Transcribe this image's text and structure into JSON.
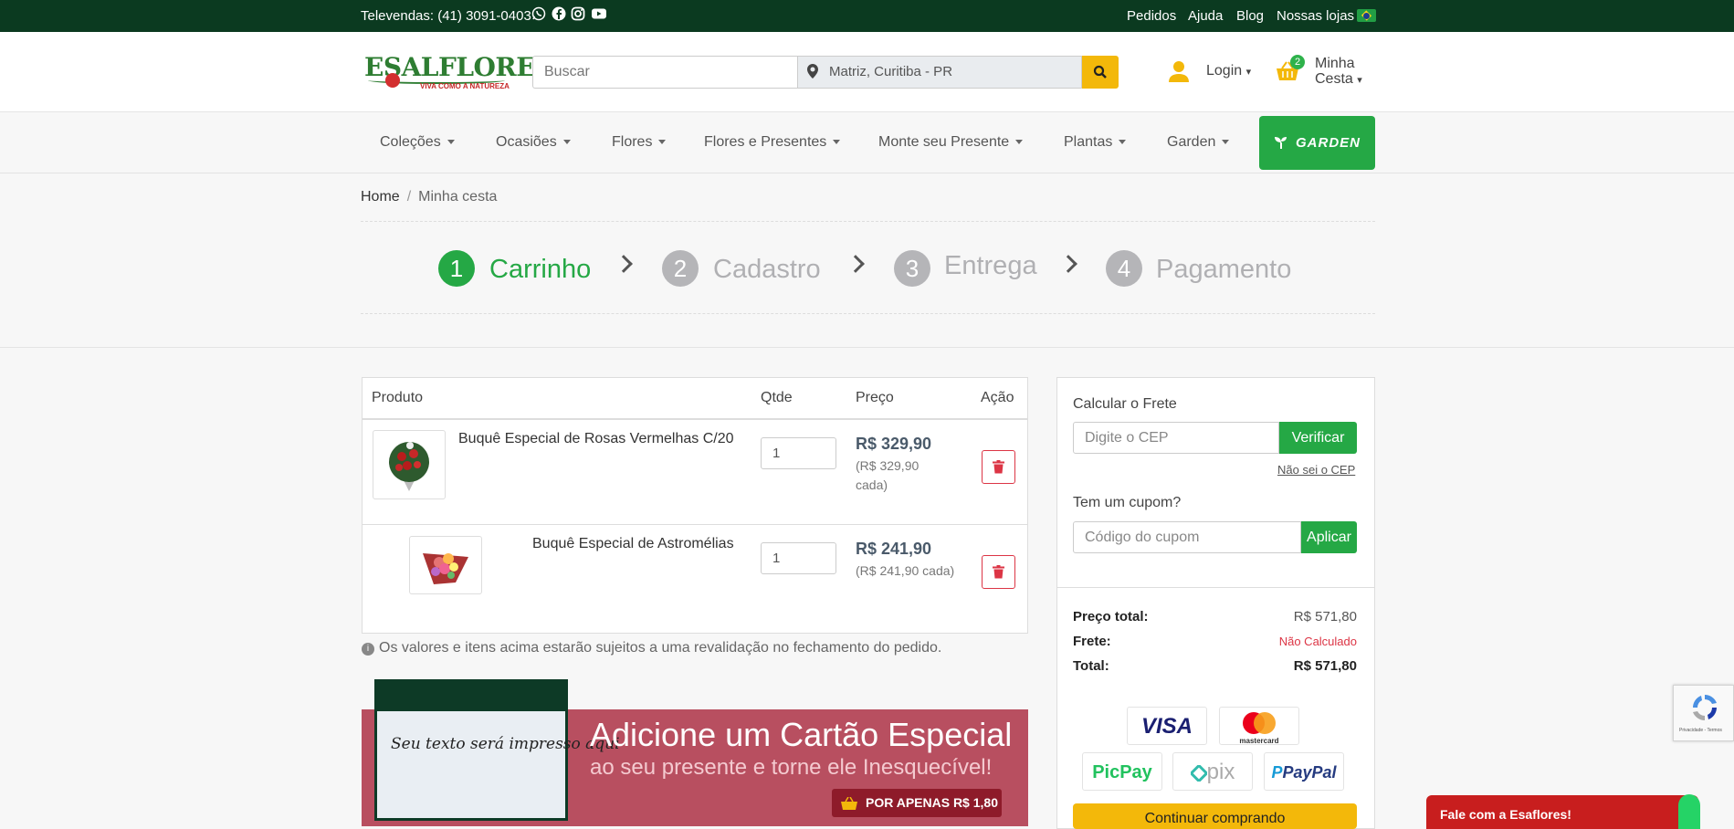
{
  "topbar": {
    "phone": "Televendas: (41) 3091-0403",
    "links": [
      "Pedidos",
      "Ajuda",
      "Blog",
      "Nossas lojas"
    ],
    "social_icons": [
      "whatsapp-icon",
      "facebook-icon",
      "instagram-icon",
      "youtube-icon"
    ]
  },
  "header": {
    "logo": "ESALFLORES",
    "logo_tagline": "VIVA COMO A NATUREZA",
    "search_placeholder": "Buscar",
    "location": "Matriz, Curitiba - PR",
    "login": "Login",
    "cart_count": "2",
    "cart_label_1": "Minha",
    "cart_label_2": "Cesta"
  },
  "nav": {
    "items": [
      "Coleções",
      "Ocasiões",
      "Flores",
      "Flores e Presentes",
      "Monte seu Presente",
      "Plantas",
      "Garden"
    ],
    "garden_button": "GARDEN"
  },
  "breadcrumb": {
    "home": "Home",
    "sep": "/",
    "current": "Minha cesta"
  },
  "steps": [
    {
      "num": "1",
      "label": "Carrinho"
    },
    {
      "num": "2",
      "label": "Cadastro"
    },
    {
      "num": "3",
      "label": "Entrega"
    },
    {
      "num": "4",
      "label": "Pagamento"
    }
  ],
  "cart": {
    "headers": {
      "product": "Produto",
      "qty": "Qtde",
      "price": "Preço",
      "action": "Ação"
    },
    "items": [
      {
        "name": "Buquê Especial de Rosas Vermelhas C/20",
        "qty": "1",
        "price": "R$ 329,90",
        "each_1": "(R$ 329,90",
        "each_2": "cada)"
      },
      {
        "name": "Buquê Especial de Astromélias",
        "qty": "1",
        "price": "R$ 241,90",
        "each_1": "(R$ 241,90 cada)",
        "each_2": ""
      }
    ],
    "note": "Os valores e itens acima estarão sujeitos a uma revalidação no fechamento do pedido."
  },
  "banner": {
    "card_text": "Seu texto será impresso aqui",
    "title": "Adicione um Cartão Especial",
    "subtitle": "ao seu presente e torne ele Inesquecível!",
    "button": "POR APENAS R$ 1,80"
  },
  "sidebar": {
    "frete_label": "Calcular o Frete",
    "cep_placeholder": "Digite o CEP",
    "verify_button": "Verificar",
    "no_cep": "Não sei o CEP",
    "coupon_label": "Tem um cupom?",
    "coupon_placeholder": "Código do cupom",
    "apply_button": "Aplicar",
    "totals": [
      {
        "label": "Preço total:",
        "value": "R$ 571,80"
      },
      {
        "label": "Frete:",
        "value": "Não Calculado"
      },
      {
        "label": "Total:",
        "value": "R$ 571,80"
      }
    ],
    "payments": [
      "VISA",
      "mastercard",
      "PicPay",
      "pix",
      "PayPal"
    ],
    "continue_button": "Continuar comprando"
  },
  "recaptcha_text": "Privacidade - Termos",
  "chat": {
    "label": "Fale com a Esaflores!"
  },
  "colors": {
    "dark_green": "#0b3a20",
    "green": "#25a845",
    "yellow": "#f3b80a",
    "red": "#dc3545",
    "banner": "#b84f60"
  }
}
